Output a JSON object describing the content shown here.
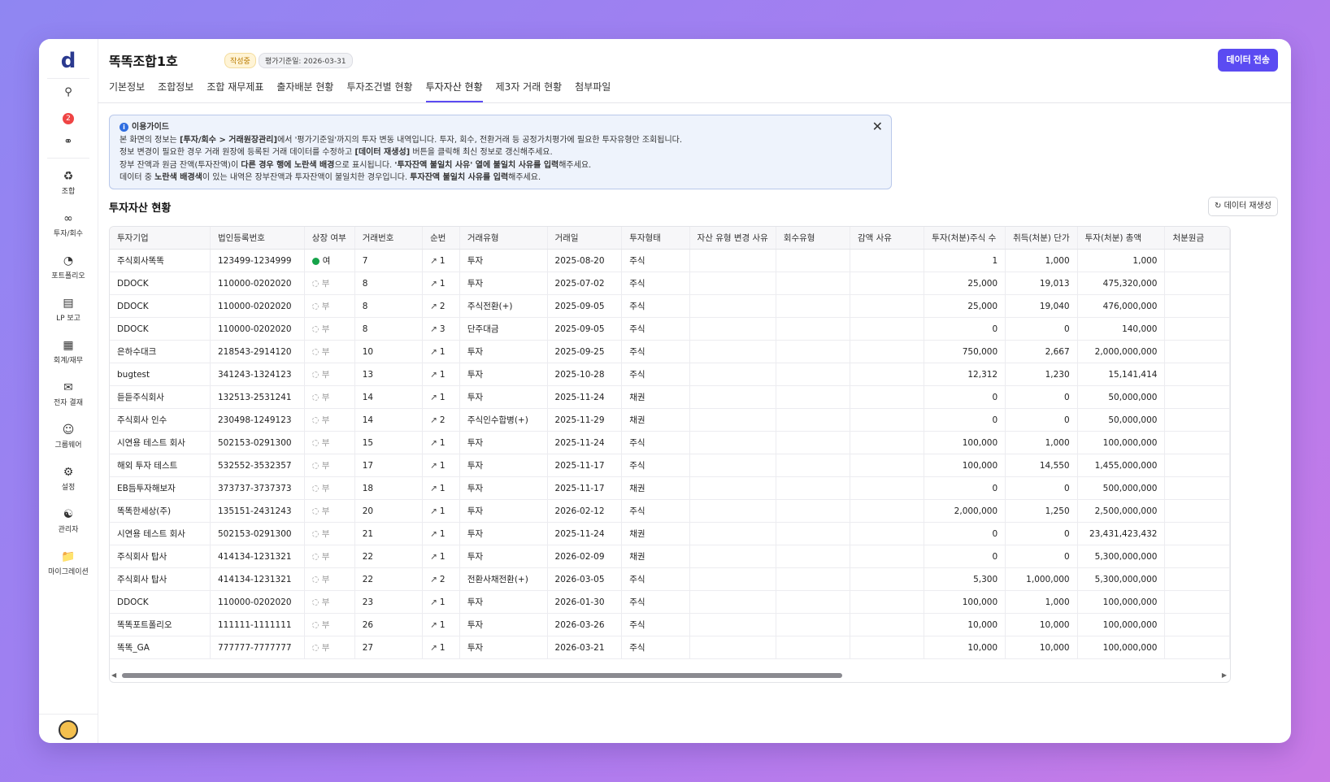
{
  "app": {
    "logo": "d",
    "badge_count": "2"
  },
  "sidebar": {
    "items": [
      {
        "icon": "union-icon",
        "label": "조합"
      },
      {
        "icon": "invest-icon",
        "label": "투자/회수"
      },
      {
        "icon": "portfolio-icon",
        "label": "포트폴리오"
      },
      {
        "icon": "report-icon",
        "label": "LP 보고"
      },
      {
        "icon": "accounting-icon",
        "label": "회계/재무"
      },
      {
        "icon": "approval-icon",
        "label": "전자 결재"
      },
      {
        "icon": "groupware-icon",
        "label": "그룹웨어"
      },
      {
        "icon": "settings-icon",
        "label": "설정"
      },
      {
        "icon": "admin-icon",
        "label": "관리자"
      },
      {
        "icon": "folder-icon",
        "label": "마이그레이션"
      }
    ]
  },
  "header": {
    "title": "똑똑조합1호",
    "status": "작성중",
    "date_badge": "평가기준일: 2026-03-31",
    "send_button": "데이터 전송"
  },
  "tabs": [
    {
      "label": "기본정보",
      "active": false
    },
    {
      "label": "조합정보",
      "active": false
    },
    {
      "label": "조합 재무제표",
      "active": false
    },
    {
      "label": "출자배분 현황",
      "active": false
    },
    {
      "label": "투자조건별 현황",
      "active": false
    },
    {
      "label": "투자자산 현황",
      "active": true
    },
    {
      "label": "제3자 거래 현황",
      "active": false
    },
    {
      "label": "첨부파일",
      "active": false
    }
  ],
  "guide": {
    "title": "이용가이드",
    "line1_a": "본 화면의 정보는 ",
    "line1_b": "[투자/회수 > 거래원장관리]",
    "line1_c": "에서 '평가기준일'까지의 투자 변동 내역입니다. 투자, 회수, 전환거래 등 공정가치평가에 필요한 투자유형만 조회됩니다.",
    "line2_a": "정보 변경이 필요한 경우 거래 원장에 등록된 거래 데이터를 수정하고 ",
    "line2_b": "[데이터 재생성]",
    "line2_c": " 버튼을 클릭해 최신 정보로 갱신해주세요.",
    "line3_a": "장부 잔액과 원금 잔액(투자잔액)이 ",
    "line3_b": "다른 경우 행에 노란색 배경",
    "line3_c": "으로 표시됩니다. ",
    "line3_d": "'투자잔액 불일치 사유' 열에 불일치 사유를 입력",
    "line3_e": "해주세요.",
    "line4_a": "데이터 중 ",
    "line4_b": "노란색 배경색",
    "line4_c": "이 있는 내역은 장부잔액과 투자잔액이 불일치한 경우입니다. ",
    "line4_d": "투자잔액 불일치 사유를 입력",
    "line4_e": "해주세요."
  },
  "section": {
    "title": "투자자산 현황",
    "regen_button": "데이터 재생성"
  },
  "table": {
    "columns": [
      "투자기업",
      "법인등록번호",
      "상장 여부",
      "거래번호",
      "순번",
      "거래유형",
      "거래일",
      "투자형태",
      "자산 유형 변경 사유",
      "회수유형",
      "감액 사유",
      "투자(처분)주식 수",
      "취득(처분) 단가",
      "투자(처분) 총액",
      "처분원금"
    ],
    "rows": [
      {
        "company": "주식회사똑똑",
        "reg": "123499-1234999",
        "listed": "여",
        "listed_yes": true,
        "txno": "7",
        "seq": "1",
        "type": "투자",
        "date": "2025-08-20",
        "form": "주식",
        "shares": "1",
        "price": "1,000",
        "total": "1,000"
      },
      {
        "company": "DDOCK",
        "reg": "110000-0202020",
        "listed": "부",
        "listed_yes": false,
        "txno": "8",
        "seq": "1",
        "type": "투자",
        "date": "2025-07-02",
        "form": "주식",
        "shares": "25,000",
        "price": "19,013",
        "total": "475,320,000"
      },
      {
        "company": "DDOCK",
        "reg": "110000-0202020",
        "listed": "부",
        "listed_yes": false,
        "txno": "8",
        "seq": "2",
        "type": "주식전환(+)",
        "date": "2025-09-05",
        "form": "주식",
        "shares": "25,000",
        "price": "19,040",
        "total": "476,000,000"
      },
      {
        "company": "DDOCK",
        "reg": "110000-0202020",
        "listed": "부",
        "listed_yes": false,
        "txno": "8",
        "seq": "3",
        "type": "단주대금",
        "date": "2025-09-05",
        "form": "주식",
        "shares": "0",
        "price": "0",
        "total": "140,000"
      },
      {
        "company": "은하수대크",
        "reg": "218543-2914120",
        "listed": "부",
        "listed_yes": false,
        "txno": "10",
        "seq": "1",
        "type": "투자",
        "date": "2025-09-25",
        "form": "주식",
        "shares": "750,000",
        "price": "2,667",
        "total": "2,000,000,000"
      },
      {
        "company": "bugtest",
        "reg": "341243-1324123",
        "listed": "부",
        "listed_yes": false,
        "txno": "13",
        "seq": "1",
        "type": "투자",
        "date": "2025-10-28",
        "form": "주식",
        "shares": "12,312",
        "price": "1,230",
        "total": "15,141,414"
      },
      {
        "company": "듣듣주식회사",
        "reg": "132513-2531241",
        "listed": "부",
        "listed_yes": false,
        "txno": "14",
        "seq": "1",
        "type": "투자",
        "date": "2025-11-24",
        "form": "채권",
        "shares": "0",
        "price": "0",
        "total": "50,000,000"
      },
      {
        "company": "주식회사 인수",
        "reg": "230498-1249123",
        "listed": "부",
        "listed_yes": false,
        "txno": "14",
        "seq": "2",
        "type": "주식인수합병(+)",
        "date": "2025-11-29",
        "form": "채권",
        "shares": "0",
        "price": "0",
        "total": "50,000,000"
      },
      {
        "company": "시연용 테스트 회사",
        "reg": "502153-0291300",
        "listed": "부",
        "listed_yes": false,
        "txno": "15",
        "seq": "1",
        "type": "투자",
        "date": "2025-11-24",
        "form": "주식",
        "shares": "100,000",
        "price": "1,000",
        "total": "100,000,000"
      },
      {
        "company": "해외 투자 테스트",
        "reg": "532552-3532357",
        "listed": "부",
        "listed_yes": false,
        "txno": "17",
        "seq": "1",
        "type": "투자",
        "date": "2025-11-17",
        "form": "주식",
        "shares": "100,000",
        "price": "14,550",
        "total": "1,455,000,000"
      },
      {
        "company": "EB듬투자해보자",
        "reg": "373737-3737373",
        "listed": "부",
        "listed_yes": false,
        "txno": "18",
        "seq": "1",
        "type": "투자",
        "date": "2025-11-17",
        "form": "채권",
        "shares": "0",
        "price": "0",
        "total": "500,000,000"
      },
      {
        "company": "똑똑한세상(주)",
        "reg": "135151-2431243",
        "listed": "부",
        "listed_yes": false,
        "txno": "20",
        "seq": "1",
        "type": "투자",
        "date": "2026-02-12",
        "form": "주식",
        "shares": "2,000,000",
        "price": "1,250",
        "total": "2,500,000,000"
      },
      {
        "company": "시연용 테스트 회사",
        "reg": "502153-0291300",
        "listed": "부",
        "listed_yes": false,
        "txno": "21",
        "seq": "1",
        "type": "투자",
        "date": "2025-11-24",
        "form": "채권",
        "shares": "0",
        "price": "0",
        "total": "23,431,423,432"
      },
      {
        "company": "주식회사 탑사",
        "reg": "414134-1231321",
        "listed": "부",
        "listed_yes": false,
        "txno": "22",
        "seq": "1",
        "type": "투자",
        "date": "2026-02-09",
        "form": "채권",
        "shares": "0",
        "price": "0",
        "total": "5,300,000,000"
      },
      {
        "company": "주식회사 탑사",
        "reg": "414134-1231321",
        "listed": "부",
        "listed_yes": false,
        "txno": "22",
        "seq": "2",
        "type": "전환사채전환(+)",
        "date": "2026-03-05",
        "form": "주식",
        "shares": "5,300",
        "price": "1,000,000",
        "total": "5,300,000,000"
      },
      {
        "company": "DDOCK",
        "reg": "110000-0202020",
        "listed": "부",
        "listed_yes": false,
        "txno": "23",
        "seq": "1",
        "type": "투자",
        "date": "2026-01-30",
        "form": "주식",
        "shares": "100,000",
        "price": "1,000",
        "total": "100,000,000"
      },
      {
        "company": "똑똑포트폴리오",
        "reg": "111111-1111111",
        "listed": "부",
        "listed_yes": false,
        "txno": "26",
        "seq": "1",
        "type": "투자",
        "date": "2026-03-26",
        "form": "주식",
        "shares": "10,000",
        "price": "10,000",
        "total": "100,000,000"
      },
      {
        "company": "똑똑_GA",
        "reg": "777777-7777777",
        "listed": "부",
        "listed_yes": false,
        "txno": "27",
        "seq": "1",
        "type": "투자",
        "date": "2026-03-21",
        "form": "주식",
        "shares": "10,000",
        "price": "10,000",
        "total": "100,000,000"
      }
    ]
  },
  "colors": {
    "accent": "#5b4bf2",
    "listed_yes": "#16a34a",
    "badge_red": "#ef4444"
  }
}
